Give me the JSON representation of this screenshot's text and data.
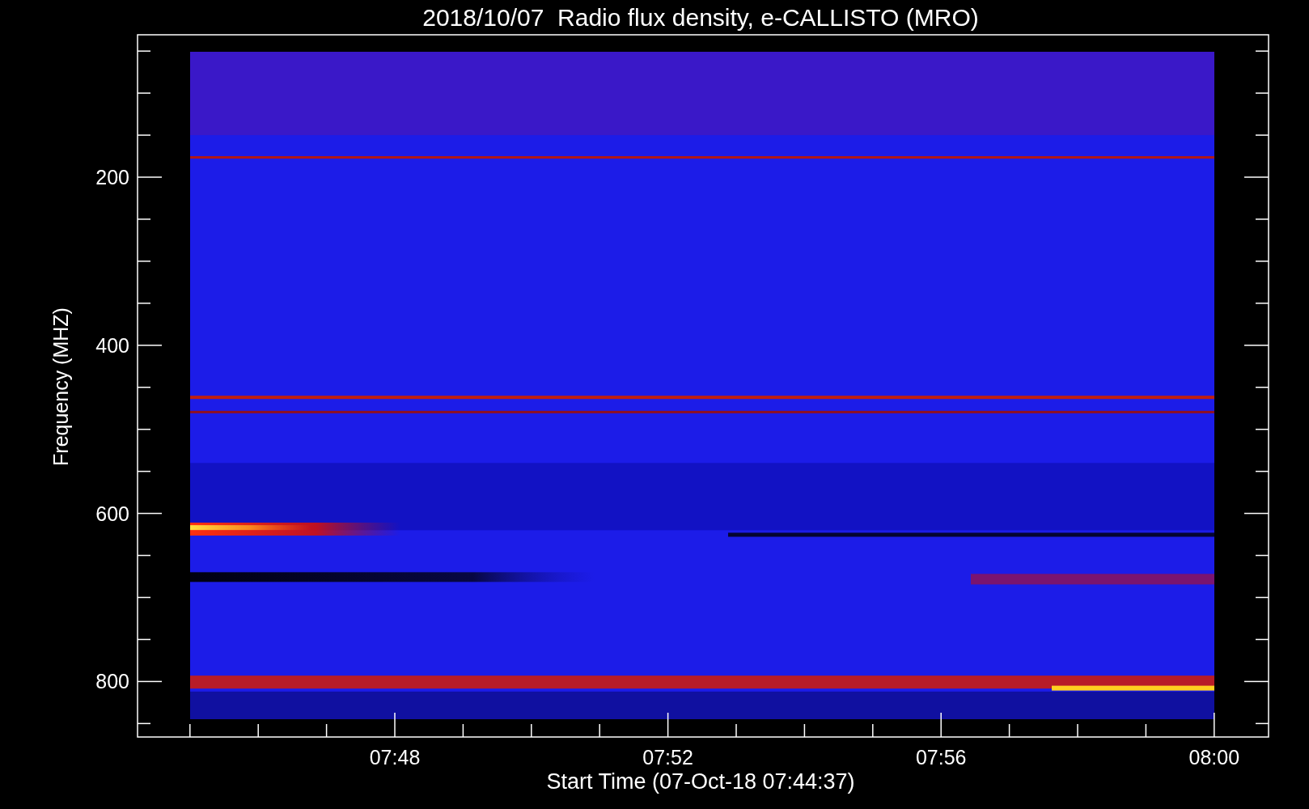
{
  "title": "2018/10/07  Radio flux density, e-CALLISTO (MRO)",
  "y_axis": {
    "label": "Frequency (MHZ)",
    "ticks": [
      "200",
      "400",
      "600",
      "800"
    ]
  },
  "x_axis": {
    "label": "Start Time (07-Oct-18 07:44:37)",
    "ticks": [
      "07:48",
      "07:52",
      "07:56",
      "08:00"
    ]
  }
}
